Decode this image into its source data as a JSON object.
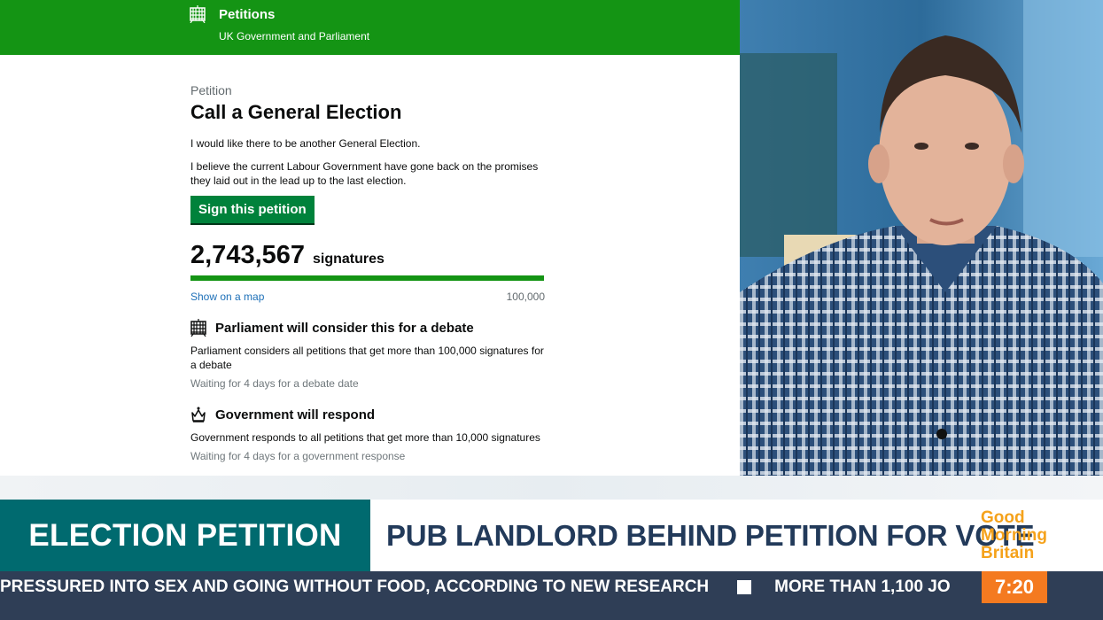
{
  "petition_page": {
    "site_title": "Petitions",
    "site_subtitle": "UK Government and Parliament",
    "eyebrow": "Petition",
    "title": "Call a General Election",
    "action": "I would like there to be another General Election.",
    "background": "I believe the current Labour Government have gone back on the promises they laid out in the lead up to the last election.",
    "sign_button": "Sign this petition",
    "signature_count": "2,743,567",
    "signature_label": "signatures",
    "progress_fraction": 1.0,
    "map_link": "Show on a map",
    "threshold_label": "100,000",
    "debate": {
      "title": "Parliament will consider this for a debate",
      "text": "Parliament considers all petitions that get more than 100,000 signatures for a debate",
      "status": "Waiting for 4 days for a debate date",
      "icon": "portcullis-icon"
    },
    "response": {
      "title": "Government will respond",
      "text": "Government responds to all petitions that get more than 10,000 signatures",
      "status": "Waiting for 4 days for a government response",
      "icon": "crown-icon"
    }
  },
  "broadcast": {
    "strap_label": "ELECTION PETITION",
    "strap_headline": "PUB LANDLORD BEHIND PETITION FOR VOTE",
    "logo": [
      "Good",
      "Morning",
      "Britain"
    ],
    "ticker_items": [
      "PRESSURED INTO SEX AND GOING WITHOUT FOOD, ACCORDING TO NEW RESEARCH",
      "MORE THAN 1,100 JO"
    ],
    "clock": "7:20"
  },
  "colors": {
    "gov_green": "#149414",
    "button_green": "#00823b",
    "strap_teal": "#006a6f",
    "headline_navy": "#223a5a",
    "logo_orange": "#f5a21b",
    "ticker_bg": "#2f3e56",
    "clock_orange": "#f47a20"
  }
}
